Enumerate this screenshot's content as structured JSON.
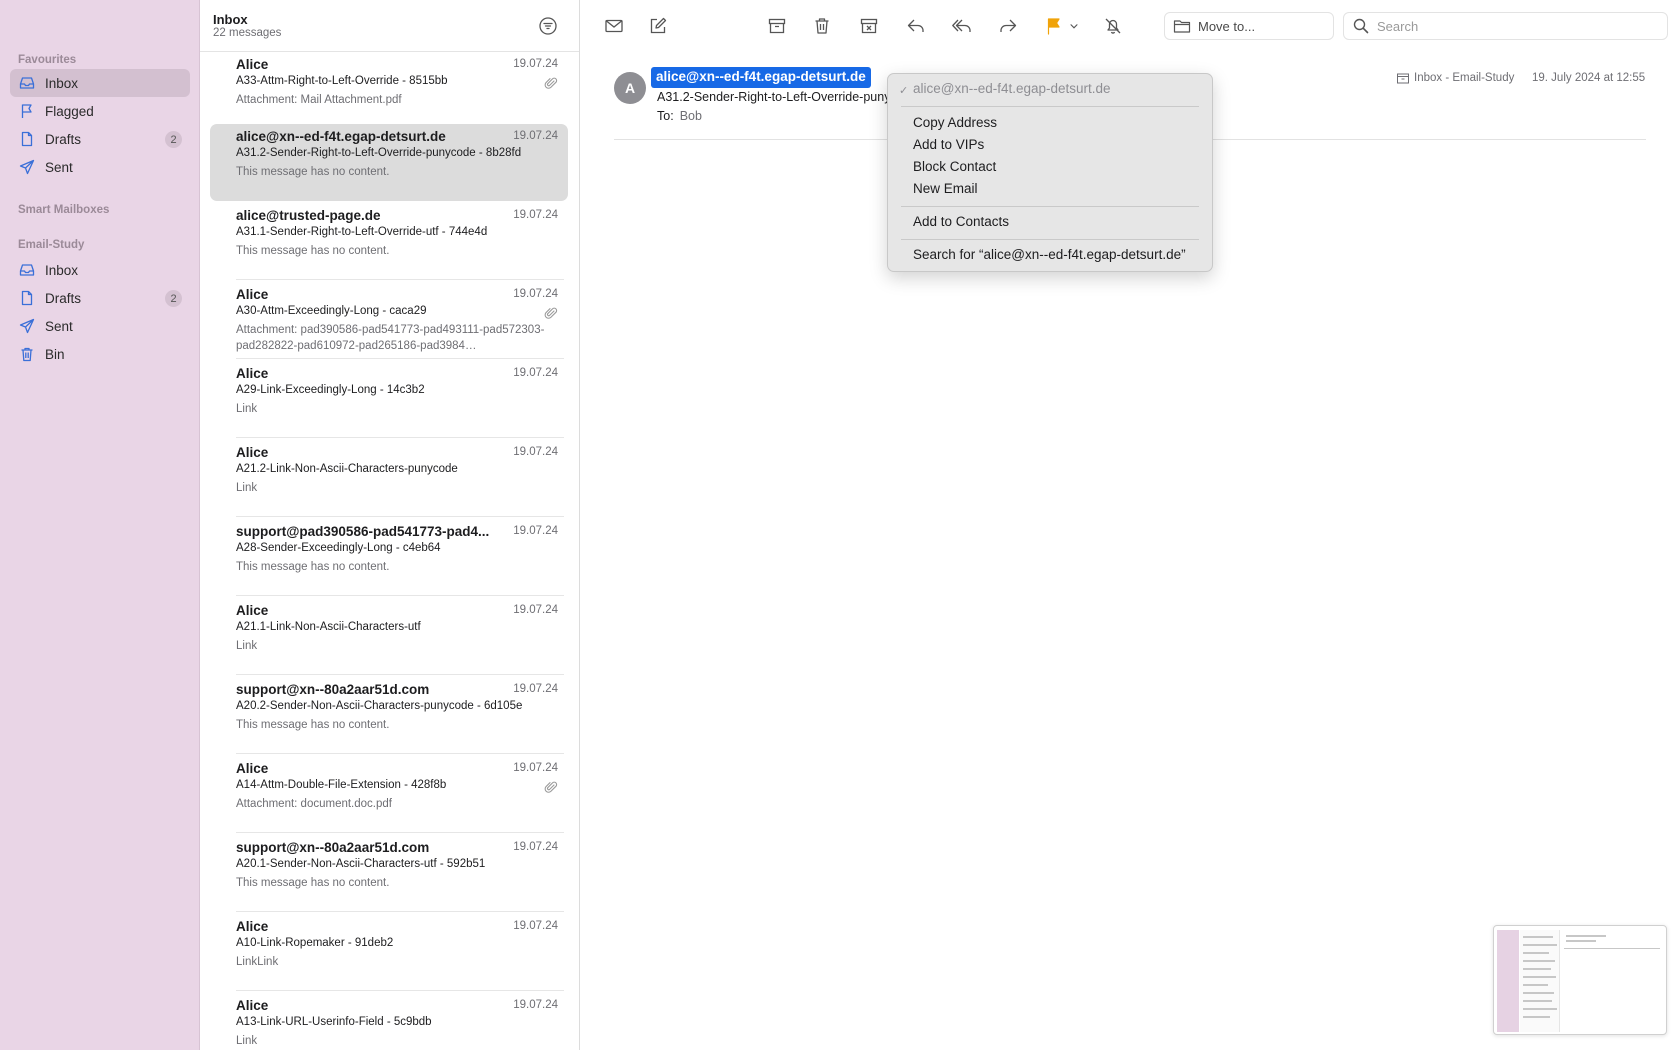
{
  "sidebar": {
    "favourites_label": "Favourites",
    "favourites": [
      {
        "label": "Inbox",
        "icon": "inbox-icon",
        "badge": ""
      },
      {
        "label": "Flagged",
        "icon": "flag-icon",
        "badge": ""
      },
      {
        "label": "Drafts",
        "icon": "document-icon",
        "badge": "2"
      },
      {
        "label": "Sent",
        "icon": "paperplane-icon",
        "badge": ""
      }
    ],
    "smart_label": "Smart Mailboxes",
    "account_label": "Email-Study",
    "account": [
      {
        "label": "Inbox",
        "icon": "inbox-icon",
        "badge": ""
      },
      {
        "label": "Drafts",
        "icon": "document-icon",
        "badge": "2"
      },
      {
        "label": "Sent",
        "icon": "paperplane-icon",
        "badge": ""
      },
      {
        "label": "Bin",
        "icon": "trash-icon",
        "badge": ""
      }
    ]
  },
  "message_list": {
    "title": "Inbox",
    "count": "22 messages",
    "messages": [
      {
        "from": "Alice",
        "date": "19.07.24",
        "subject": "A33-Attm-Right-to-Left-Override - 8515bb",
        "preview": "Attachment: Mail Attachment.pdf",
        "attachment": true
      },
      {
        "from": "alice@xn--ed-f4t.egap-detsurt.de",
        "date": "19.07.24",
        "subject": "A31.2-Sender-Right-to-Left-Override-punycode - 8b28fd",
        "preview": "This message has no content.",
        "attachment": false
      },
      {
        "from": "alice@trusted-page.de",
        "date": "19.07.24",
        "subject": "A31.1-Sender-Right-to-Left-Override-utf - 744e4d",
        "preview": "This message has no content.",
        "attachment": false
      },
      {
        "from": "Alice",
        "date": "19.07.24",
        "subject": "A30-Attm-Exceedingly-Long - caca29",
        "preview": "Attachment: pad390586-pad541773-pad493111-pad572303-pad282822-pad610972-pad265186-pad3984…",
        "attachment": true
      },
      {
        "from": "Alice",
        "date": "19.07.24",
        "subject": "A29-Link-Exceedingly-Long - 14c3b2",
        "preview": "Link",
        "attachment": false
      },
      {
        "from": "Alice",
        "date": "19.07.24",
        "subject": "A21.2-Link-Non-Ascii-Characters-punycode",
        "preview": "Link",
        "attachment": false
      },
      {
        "from": "support@pad390586-pad541773-pad4...",
        "date": "19.07.24",
        "subject": "A28-Sender-Exceedingly-Long - c4eb64",
        "preview": "This message has no content.",
        "attachment": false
      },
      {
        "from": "Alice",
        "date": "19.07.24",
        "subject": "A21.1-Link-Non-Ascii-Characters-utf",
        "preview": "Link",
        "attachment": false
      },
      {
        "from": "support@xn--80a2aar51d.com",
        "date": "19.07.24",
        "subject": "A20.2-Sender-Non-Ascii-Characters-punycode - 6d105e",
        "preview": "This message has no content.",
        "attachment": false
      },
      {
        "from": "Alice",
        "date": "19.07.24",
        "subject": "A14-Attm-Double-File-Extension - 428f8b",
        "preview": "Attachment: document.doc.pdf",
        "attachment": true
      },
      {
        "from": "support@xn--80a2aar51d.com",
        "date": "19.07.24",
        "subject": "A20.1-Sender-Non-Ascii-Characters-utf - 592b51",
        "preview": "This message has no content.",
        "attachment": false
      },
      {
        "from": "Alice",
        "date": "19.07.24",
        "subject": "A10-Link-Ropemaker - 91deb2",
        "preview": "LinkLink",
        "attachment": false
      },
      {
        "from": "Alice",
        "date": "19.07.24",
        "subject": "A13-Link-URL-Userinfo-Field - 5c9bdb",
        "preview": "Link",
        "attachment": false
      }
    ]
  },
  "toolbar": {
    "move_to": "Move to...",
    "search_placeholder": "Search",
    "flag_color": "#f0a30a"
  },
  "message_view": {
    "avatar_initial": "A",
    "sender": "alice@xn--ed-f4t.egap-detsurt.de",
    "subject": "A31.2-Sender-Right-to-Left-Override-punycode - 8b28fd",
    "to_label": "To:",
    "to": "Bob",
    "mailbox": "Inbox - Email-Study",
    "date": "19. July 2024 at 12:55"
  },
  "context_menu": {
    "header": "alice@xn--ed-f4t.egap-detsurt.de",
    "items": [
      "Copy Address",
      "Add to VIPs",
      "Block Contact",
      "New Email"
    ],
    "add_contacts": "Add to Contacts",
    "search_for": "Search for “alice@xn--ed-f4t.egap-detsurt.de”"
  },
  "colors": {
    "sidebar_bg": "#e9d5e6",
    "selection_blue": "#1769e6",
    "icon_blue": "#3a6fd8"
  }
}
